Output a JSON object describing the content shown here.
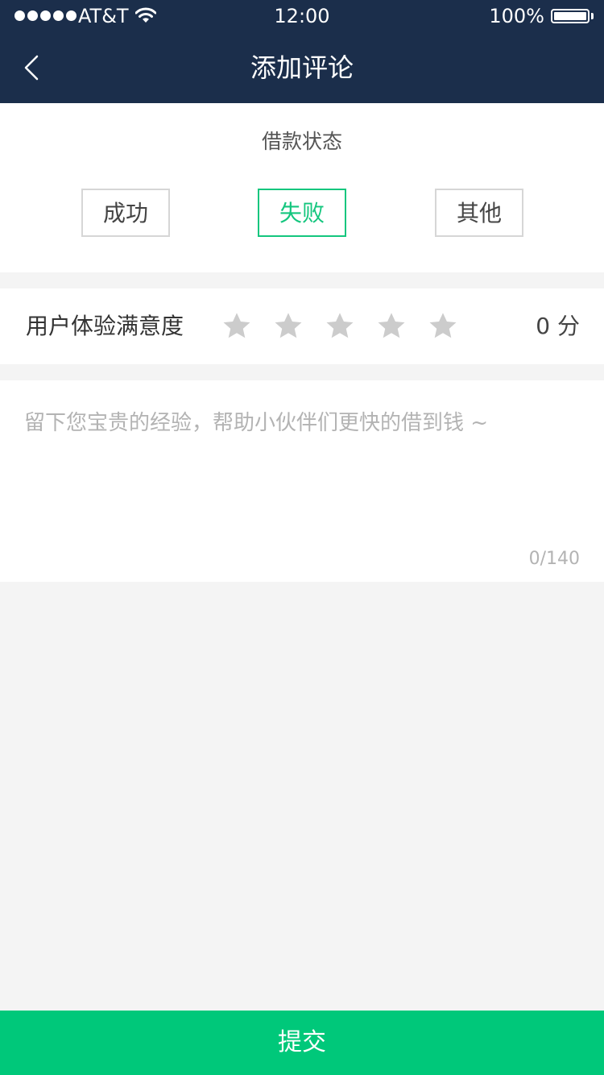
{
  "status_bar": {
    "carrier": "AT&T",
    "time": "12:00",
    "battery": "100%",
    "battery_level": 1.0,
    "signal_bars": 5,
    "wifi_icon": "wifi-icon"
  },
  "nav": {
    "title": "添加评论",
    "back_icon": "chevron-left-icon"
  },
  "loan_status": {
    "title": "借款状态",
    "options": [
      "成功",
      "失败",
      "其他"
    ],
    "selected": "失败"
  },
  "rating": {
    "label": "用户体验满意度",
    "max_stars": 5,
    "value": 0,
    "score_text": "0 分",
    "star_icon": "star-icon"
  },
  "comment": {
    "value": "",
    "placeholder": "留下您宝贵的经验，帮助小伙伴们更快的借到钱 ~",
    "counter": "0/140"
  },
  "submit": {
    "label": "提交"
  },
  "colors": {
    "nav_background": "#1b2e4b",
    "accent": "#14c67e",
    "submit_background": "#00c87a",
    "page_background": "#f4f4f4",
    "star_inactive": "#cccccc"
  }
}
